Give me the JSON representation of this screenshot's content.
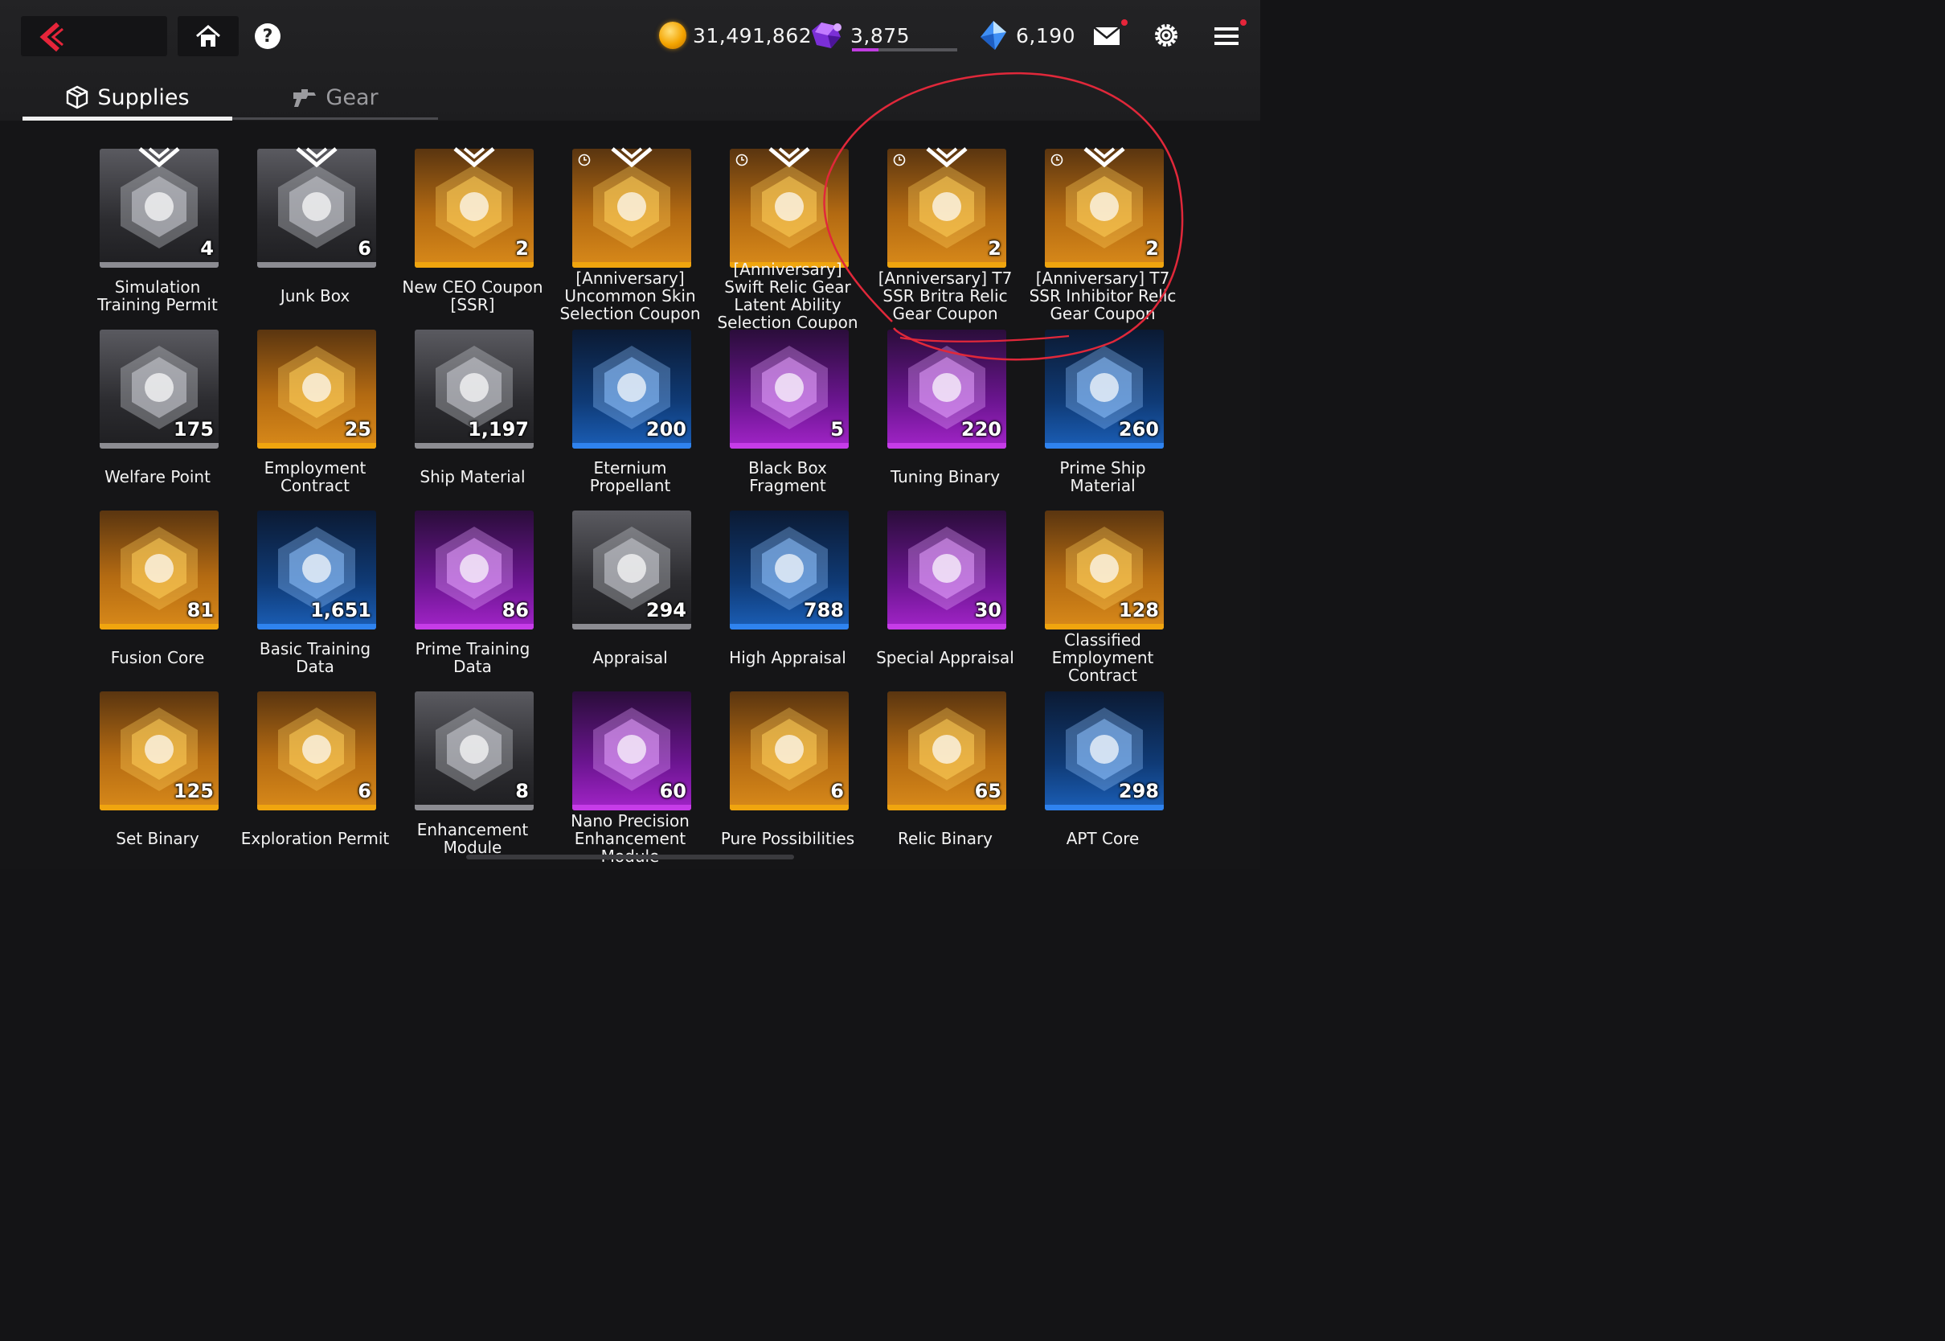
{
  "header": {
    "back_label": "Back",
    "currencies": [
      {
        "icon": "gold-coin-icon",
        "value": "31,491,862"
      },
      {
        "icon": "purple-gem-icon",
        "value": "3,875",
        "progress": 0.25
      },
      {
        "icon": "blue-crystal-icon",
        "value": "6,190"
      }
    ],
    "mail_has_badge": true,
    "menu_has_badge": true
  },
  "tabs": [
    {
      "label": "Supplies",
      "icon": "cube-icon",
      "active": true
    },
    {
      "label": "Gear",
      "icon": "gear-gun-icon",
      "active": false
    }
  ],
  "items": [
    {
      "name": "Simulation Training Permit",
      "count": "4",
      "rarity": "silver",
      "timed": false,
      "new": true
    },
    {
      "name": "Junk Box",
      "count": "6",
      "rarity": "silver",
      "timed": false,
      "new": true
    },
    {
      "name": "New CEO Coupon [SSR]",
      "count": "2",
      "rarity": "gold",
      "timed": false,
      "new": true
    },
    {
      "name": "[Anniversary] Uncommon Skin Selection Coupon",
      "count": "",
      "rarity": "gold",
      "timed": true,
      "new": true
    },
    {
      "name": "[Anniversary] Swift Relic Gear Latent Ability Selection Coupon",
      "count": "",
      "rarity": "gold",
      "timed": true,
      "new": true
    },
    {
      "name": "[Anniversary] T7 SSR Britra Relic Gear Coupon",
      "count": "2",
      "rarity": "gold",
      "timed": true,
      "new": true
    },
    {
      "name": "[Anniversary] T7 SSR Inhibitor Relic Gear Coupon",
      "count": "2",
      "rarity": "gold",
      "timed": true,
      "new": true
    },
    {
      "name": "Welfare Point",
      "count": "175",
      "rarity": "silver",
      "timed": false,
      "new": false
    },
    {
      "name": "Employment Contract",
      "count": "25",
      "rarity": "gold",
      "timed": false,
      "new": false
    },
    {
      "name": "Ship Material",
      "count": "1,197",
      "rarity": "silver",
      "timed": false,
      "new": false
    },
    {
      "name": "Eternium Propellant",
      "count": "200",
      "rarity": "blue",
      "timed": false,
      "new": false
    },
    {
      "name": "Black Box Fragment",
      "count": "5",
      "rarity": "purple",
      "timed": false,
      "new": false
    },
    {
      "name": "Tuning Binary",
      "count": "220",
      "rarity": "purple",
      "timed": false,
      "new": false
    },
    {
      "name": "Prime Ship Material",
      "count": "260",
      "rarity": "blue",
      "timed": false,
      "new": false
    },
    {
      "name": "Fusion Core",
      "count": "81",
      "rarity": "gold",
      "timed": false,
      "new": false
    },
    {
      "name": "Basic Training Data",
      "count": "1,651",
      "rarity": "blue",
      "timed": false,
      "new": false
    },
    {
      "name": "Prime Training Data",
      "count": "86",
      "rarity": "purple",
      "timed": false,
      "new": false
    },
    {
      "name": "Appraisal",
      "count": "294",
      "rarity": "silver",
      "timed": false,
      "new": false
    },
    {
      "name": "High Appraisal",
      "count": "788",
      "rarity": "blue",
      "timed": false,
      "new": false
    },
    {
      "name": "Special Appraisal",
      "count": "30",
      "rarity": "purple",
      "timed": false,
      "new": false
    },
    {
      "name": "Classified Employment Contract",
      "count": "128",
      "rarity": "gold",
      "timed": false,
      "new": false
    },
    {
      "name": "Set Binary",
      "count": "125",
      "rarity": "gold",
      "timed": false,
      "new": false
    },
    {
      "name": "Exploration Permit",
      "count": "6",
      "rarity": "gold",
      "timed": false,
      "new": false
    },
    {
      "name": "Enhancement Module",
      "count": "8",
      "rarity": "silver",
      "timed": false,
      "new": false
    },
    {
      "name": "Nano Precision Enhancement Module",
      "count": "60",
      "rarity": "purple",
      "timed": false,
      "new": false
    },
    {
      "name": "Pure Possibilities",
      "count": "6",
      "rarity": "gold",
      "timed": false,
      "new": false
    },
    {
      "name": "Relic Binary",
      "count": "65",
      "rarity": "gold",
      "timed": false,
      "new": false
    },
    {
      "name": "APT Core",
      "count": "298",
      "rarity": "blue",
      "timed": false,
      "new": false
    }
  ],
  "colors": {
    "accent_red": "#e6253a",
    "annotation_red": "#e0283a",
    "silver": "#8c8c92",
    "gold": "#f0a50e",
    "blue": "#2f83ef",
    "purple": "#c63ce8"
  }
}
